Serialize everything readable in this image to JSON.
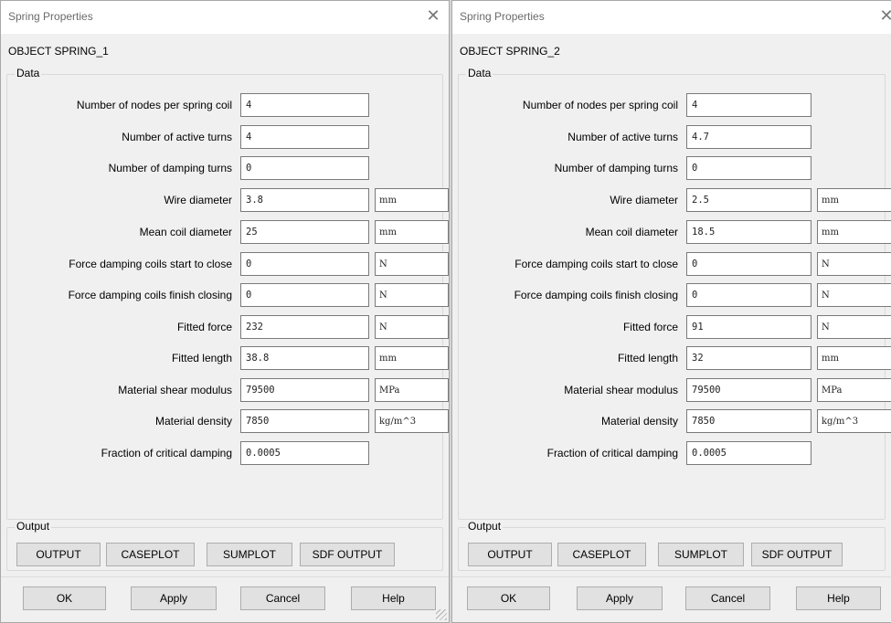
{
  "dialogs": [
    {
      "title": "Spring Properties",
      "object": "OBJECT  SPRING_1",
      "data_group_label": "Data",
      "fields": [
        {
          "label": "Number of nodes per spring coil",
          "value": "4",
          "unit": null
        },
        {
          "label": "Number of active turns",
          "value": "4",
          "unit": null
        },
        {
          "label": "Number of damping turns",
          "value": "0",
          "unit": null
        },
        {
          "label": "Wire diameter",
          "value": "3.8",
          "unit": "mm"
        },
        {
          "label": "Mean coil diameter",
          "value": "25",
          "unit": "mm"
        },
        {
          "label": "Force damping coils start to close",
          "value": "0",
          "unit": "N"
        },
        {
          "label": "Force damping coils finish closing",
          "value": "0",
          "unit": "N"
        },
        {
          "label": "Fitted force",
          "value": "232",
          "unit": "N"
        },
        {
          "label": "Fitted length",
          "value": "38.8",
          "unit": "mm"
        },
        {
          "label": "Material shear modulus",
          "value": "79500",
          "unit": "MPa"
        },
        {
          "label": "Material density",
          "value": "7850",
          "unit": "kg/m^3"
        },
        {
          "label": "Fraction of critical damping",
          "value": "0.0005",
          "unit": null
        }
      ],
      "output_group_label": "Output",
      "output_buttons": [
        "OUTPUT",
        "CASEPLOT",
        "SUMPLOT",
        "SDF OUTPUT"
      ],
      "footer_buttons": [
        "OK",
        "Apply",
        "Cancel",
        "Help"
      ]
    },
    {
      "title": "Spring Properties",
      "object": "OBJECT  SPRING_2",
      "data_group_label": "Data",
      "fields": [
        {
          "label": "Number of nodes per spring coil",
          "value": "4",
          "unit": null
        },
        {
          "label": "Number of active turns",
          "value": "4.7",
          "unit": null
        },
        {
          "label": "Number of damping turns",
          "value": "0",
          "unit": null
        },
        {
          "label": "Wire diameter",
          "value": "2.5",
          "unit": "mm"
        },
        {
          "label": "Mean coil diameter",
          "value": "18.5",
          "unit": "mm"
        },
        {
          "label": "Force damping coils start to close",
          "value": "0",
          "unit": "N"
        },
        {
          "label": "Force damping coils finish closing",
          "value": "0",
          "unit": "N"
        },
        {
          "label": "Fitted force",
          "value": "91",
          "unit": "N"
        },
        {
          "label": "Fitted length",
          "value": "32",
          "unit": "mm"
        },
        {
          "label": "Material shear modulus",
          "value": "79500",
          "unit": "MPa"
        },
        {
          "label": "Material density",
          "value": "7850",
          "unit": "kg/m^3"
        },
        {
          "label": "Fraction of critical damping",
          "value": "0.0005",
          "unit": null
        }
      ],
      "output_group_label": "Output",
      "output_buttons": [
        "OUTPUT",
        "CASEPLOT",
        "SUMPLOT",
        "SDF OUTPUT"
      ],
      "footer_buttons": [
        "OK",
        "Apply",
        "Cancel",
        "Help"
      ]
    }
  ],
  "icons": {
    "close": "close-icon",
    "resize": "resize-grip-icon"
  }
}
